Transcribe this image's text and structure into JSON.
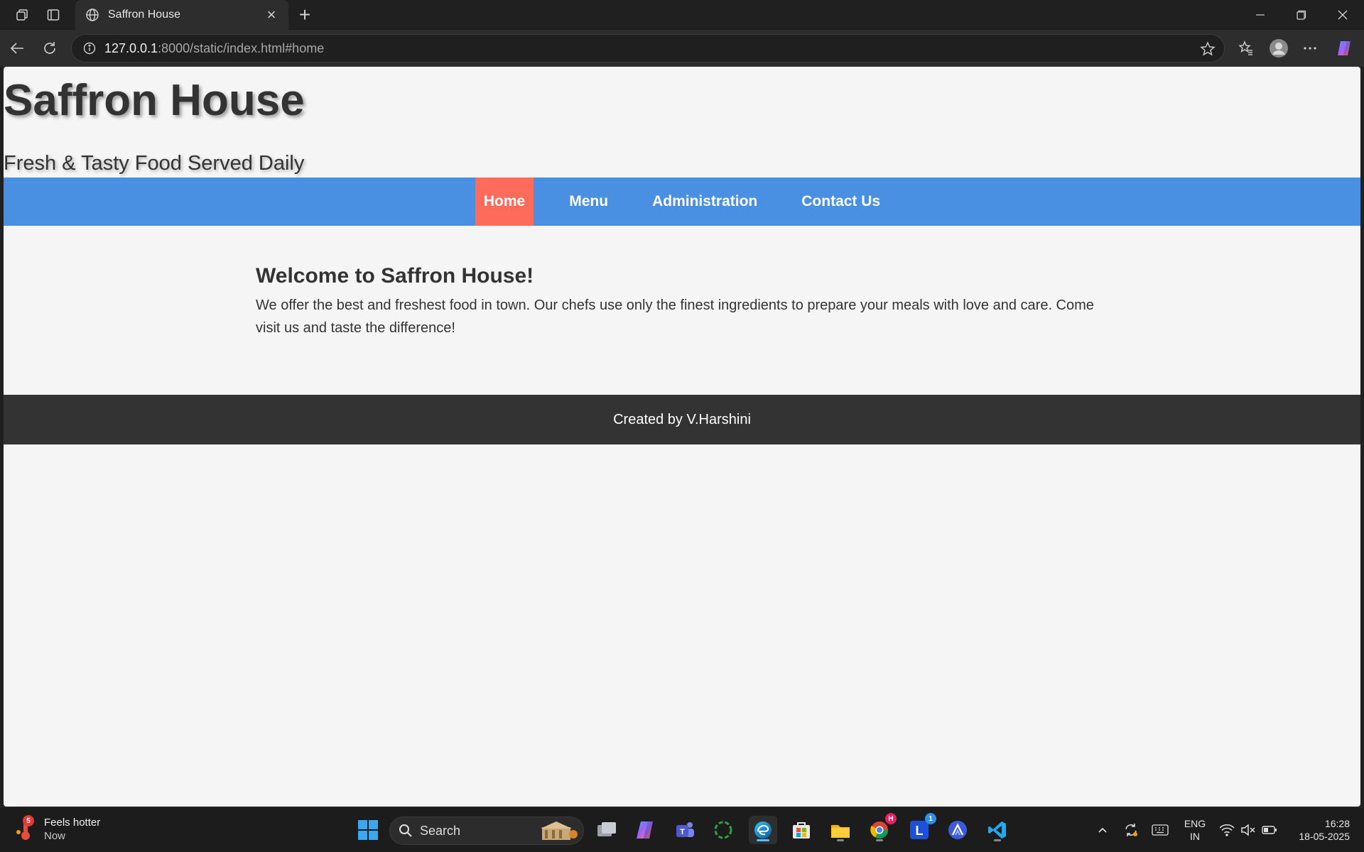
{
  "browser": {
    "tab_title": "Saffron House",
    "url_host": "127.0.0.1",
    "url_rest": ":8000/static/index.html#home"
  },
  "site": {
    "title": "Saffron House",
    "tagline": "Fresh & Tasty Food Served Daily",
    "nav": [
      {
        "label": "Home",
        "active": true
      },
      {
        "label": "Menu",
        "active": false
      },
      {
        "label": "Administration",
        "active": false
      },
      {
        "label": "Contact Us",
        "active": false
      }
    ],
    "welcome": {
      "heading": "Welcome to Saffron House!",
      "body": "We offer the best and freshest food in town. Our chefs use only the finest ingredients to prepare your meals with love and care. Come visit us and taste the difference!"
    },
    "footer": "Created by V.Harshini",
    "colors": {
      "nav_bg": "#4a90e2",
      "nav_active": "#ff6b5b",
      "footer_bg": "#333333",
      "page_bg": "#f5f5f5"
    }
  },
  "taskbar": {
    "weather_badge": "5",
    "weather_title": "Feels hotter",
    "weather_sub": "Now",
    "search_placeholder": "Search",
    "chrome_badge": "H",
    "l_badge": "1",
    "lang_line1": "ENG",
    "lang_line2": "IN",
    "time": "16:28",
    "date": "18-05-2025"
  }
}
